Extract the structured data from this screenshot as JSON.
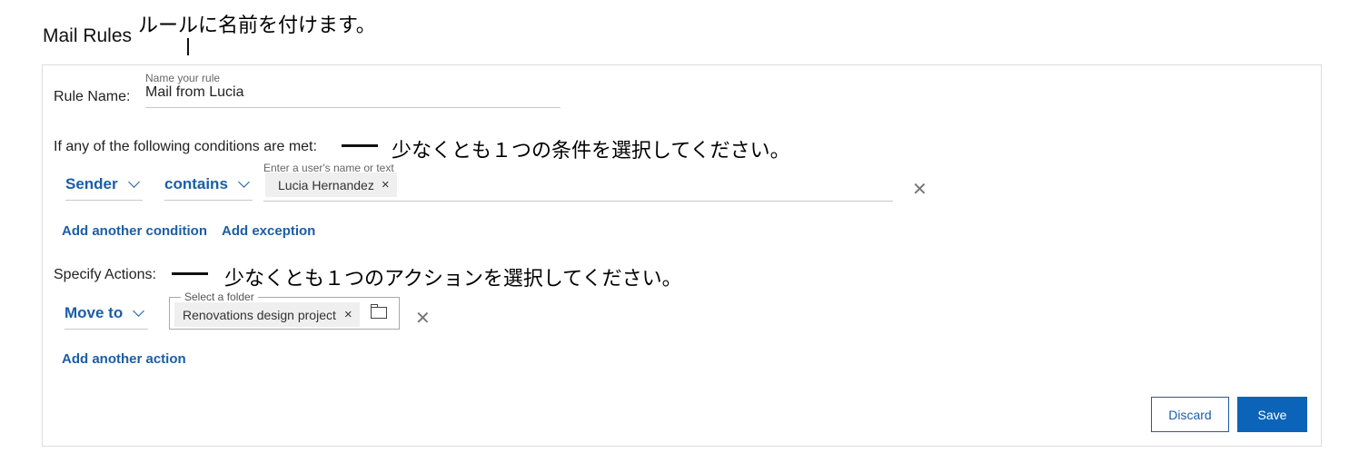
{
  "page_title": "Mail Rules",
  "callouts": {
    "rule_name": "ルールに名前を付けます。",
    "conditions": "少なくとも１つの条件を選択してください。",
    "actions": "少なくとも１つのアクションを選択してください。"
  },
  "rule_name": {
    "label": "Rule Name:",
    "helper": "Name your rule",
    "value": "Mail from Lucia"
  },
  "conditions": {
    "heading": "If any of the following conditions are met:",
    "field_dropdown": "Sender",
    "operator_dropdown": "contains",
    "value_helper": "Enter a user's name or text",
    "value_chip": "Lucia Hernandez",
    "add_condition": "Add another condition",
    "add_exception": "Add exception"
  },
  "actions": {
    "heading": "Specify Actions:",
    "action_dropdown": "Move to",
    "folder_helper": "Select a folder",
    "folder_chip": "Renovations design project",
    "add_action": "Add another action"
  },
  "buttons": {
    "discard": "Discard",
    "save": "Save"
  },
  "icons": {
    "chip_remove": "×",
    "row_remove": "✕"
  },
  "colors": {
    "accent": "#1a5ea8",
    "primary_button": "#0b64b8"
  }
}
